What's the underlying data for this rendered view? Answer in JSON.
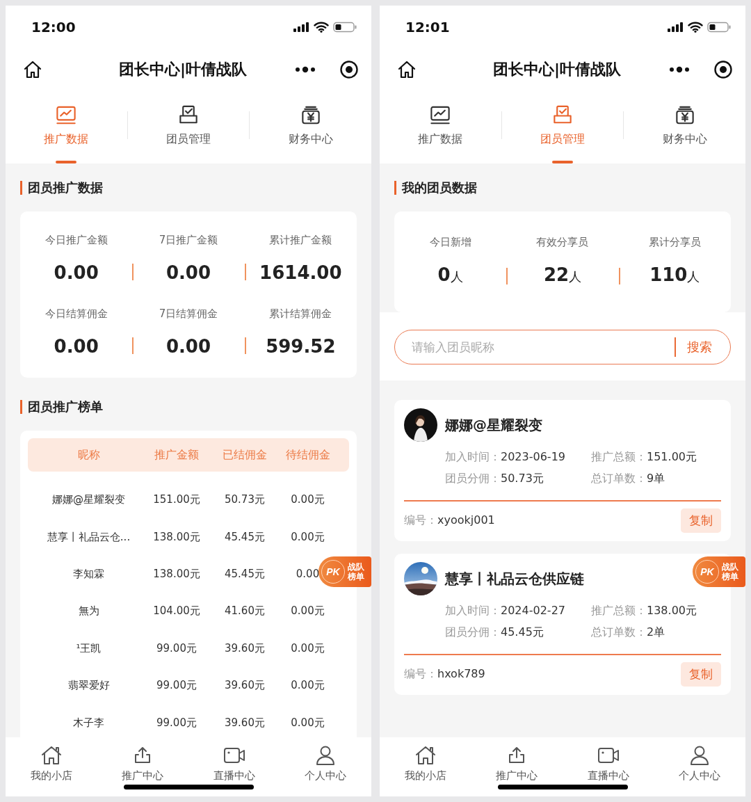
{
  "phones": [
    {
      "status_bar": {
        "time": "12:00"
      },
      "header": {
        "title": "团长中心|叶倩战队"
      },
      "tabs": [
        {
          "label": "推广数据",
          "selected": true
        },
        {
          "label": "团员管理",
          "selected": false
        },
        {
          "label": "财务中心",
          "selected": false
        }
      ],
      "sections": [
        {
          "kind": "stats",
          "title": "团员推广数据",
          "rows": [
            [
              {
                "label": "今日推广金额",
                "value": "0.00"
              },
              {
                "label": "7日推广金额",
                "value": "0.00"
              },
              {
                "label": "累计推广金额",
                "value": "1614.00"
              }
            ],
            [
              {
                "label": "今日结算佣金",
                "value": "0.00"
              },
              {
                "label": "7日结算佣金",
                "value": "0.00"
              },
              {
                "label": "累计结算佣金",
                "value": "599.52"
              }
            ]
          ]
        },
        {
          "kind": "table",
          "title": "团员推广榜单",
          "columns": [
            "昵称",
            "推广金额",
            "已结佣金",
            "待结佣金"
          ],
          "rows": [
            [
              "娜娜@星耀裂变",
              "151.00元",
              "50.73元",
              "0.00元"
            ],
            [
              "慧享丨礼品云仓...",
              "138.00元",
              "45.45元",
              "0.00元"
            ],
            [
              "李知霖",
              "138.00元",
              "45.45元",
              "0.00"
            ],
            [
              "無为",
              "104.00元",
              "41.60元",
              "0.00元"
            ],
            [
              "¹王凯",
              "99.00元",
              "39.60元",
              "0.00元"
            ],
            [
              "翡翠爱好",
              "99.00元",
              "39.60元",
              "0.00元"
            ],
            [
              "木子李",
              "99.00元",
              "39.60元",
              "0.00元"
            ]
          ]
        }
      ],
      "pk_badge": {
        "mark": "PK",
        "lines": [
          "战队",
          "榜单"
        ]
      },
      "nav": [
        {
          "label": "我的小店"
        },
        {
          "label": "推广中心"
        },
        {
          "label": "直播中心"
        },
        {
          "label": "个人中心"
        }
      ]
    },
    {
      "status_bar": {
        "time": "12:01"
      },
      "header": {
        "title": "团长中心|叶倩战队"
      },
      "tabs": [
        {
          "label": "推广数据",
          "selected": false
        },
        {
          "label": "团员管理",
          "selected": true
        },
        {
          "label": "财务中心",
          "selected": false
        }
      ],
      "sections": [
        {
          "kind": "stats",
          "title": "我的团员数据",
          "rows": [
            [
              {
                "label": "今日新增",
                "value": "0",
                "unit": "人"
              },
              {
                "label": "有效分享员",
                "value": "22",
                "unit": "人"
              },
              {
                "label": "累计分享员",
                "value": "110",
                "unit": "人"
              }
            ]
          ]
        },
        {
          "kind": "search",
          "placeholder": "请输入团员昵称",
          "button": "搜索"
        },
        {
          "kind": "members",
          "members": [
            {
              "name": "娜娜@星耀裂变",
              "fields": [
                {
                  "label": "加入时间：",
                  "value": "2023-06-19"
                },
                {
                  "label": "推广总额：",
                  "value": "151.00元"
                },
                {
                  "label": "团员分佣：",
                  "value": "50.73元"
                },
                {
                  "label": "总订单数：",
                  "value": "9单"
                }
              ],
              "id_label": "编号：",
              "id": "xyookj001",
              "copy": "复制"
            },
            {
              "name": "慧享丨礼品云仓供应链",
              "fields": [
                {
                  "label": "加入时间：",
                  "value": "2024-02-27"
                },
                {
                  "label": "推广总额：",
                  "value": "138.00元"
                },
                {
                  "label": "团员分佣：",
                  "value": "45.45元"
                },
                {
                  "label": "总订单数：",
                  "value": "2单"
                }
              ],
              "id_label": "编号：",
              "id": "hxok789",
              "copy": "复制"
            }
          ]
        }
      ],
      "pk_badge": {
        "mark": "PK",
        "lines": [
          "战队",
          "榜单"
        ]
      },
      "nav": [
        {
          "label": "我的小店"
        },
        {
          "label": "推广中心"
        },
        {
          "label": "直播中心"
        },
        {
          "label": "个人中心"
        }
      ]
    }
  ]
}
